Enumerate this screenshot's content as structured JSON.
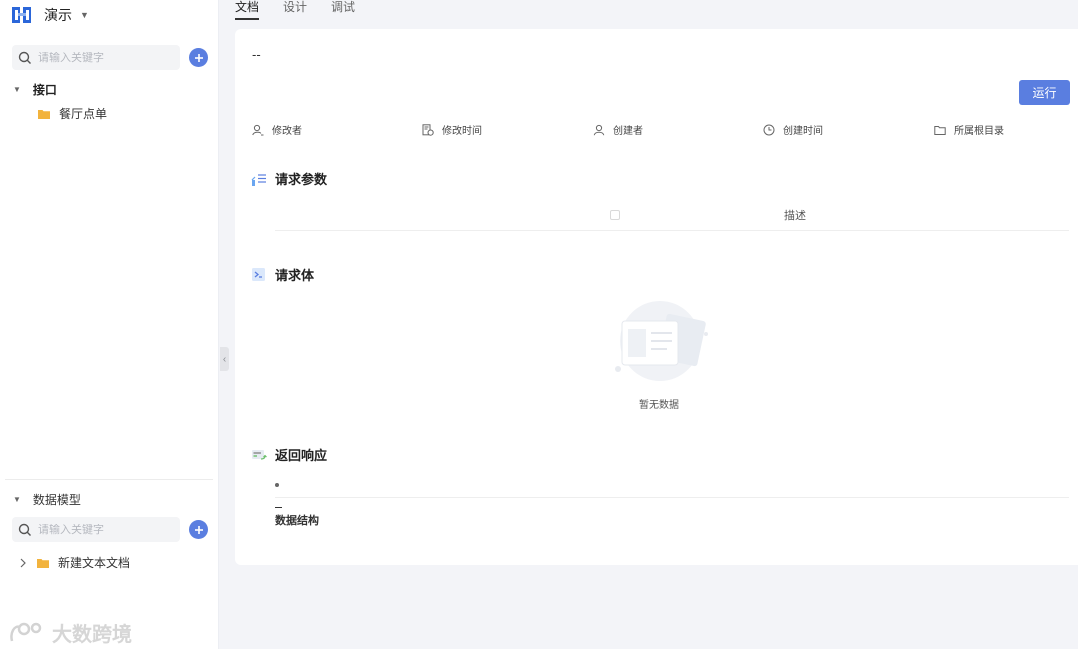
{
  "project": {
    "name": "演示"
  },
  "sidebar": {
    "search_placeholder": "请输入关键字",
    "section_title": "接口",
    "items": [
      {
        "label": "餐厅点单"
      }
    ],
    "models": {
      "title": "数据模型",
      "search_placeholder": "请输入关键字",
      "items": [
        {
          "label": "新建文本文档"
        }
      ]
    },
    "watermark": "大数跨境"
  },
  "tabs": [
    {
      "label": "文档",
      "active": true
    },
    {
      "label": "设计",
      "active": false
    },
    {
      "label": "调试",
      "active": false
    }
  ],
  "doc": {
    "api_name": "--",
    "run_label": "运行",
    "meta": [
      {
        "label": "修改者",
        "icon": "user-edit-icon"
      },
      {
        "label": "修改时间",
        "icon": "doc-clock-icon"
      },
      {
        "label": "创建者",
        "icon": "user-icon"
      },
      {
        "label": "创建时间",
        "icon": "clock-icon"
      },
      {
        "label": "所属根目录",
        "icon": "folder-outline-icon"
      }
    ],
    "request_params": {
      "title": "请求参数",
      "desc_header": "描述"
    },
    "request_body": {
      "title": "请求体",
      "empty_text": "暂无数据"
    },
    "response": {
      "title": "返回响应",
      "struct_label": "数据结构"
    }
  },
  "colors": {
    "accent": "#5a7ee0",
    "folder": "#f2b33d"
  }
}
